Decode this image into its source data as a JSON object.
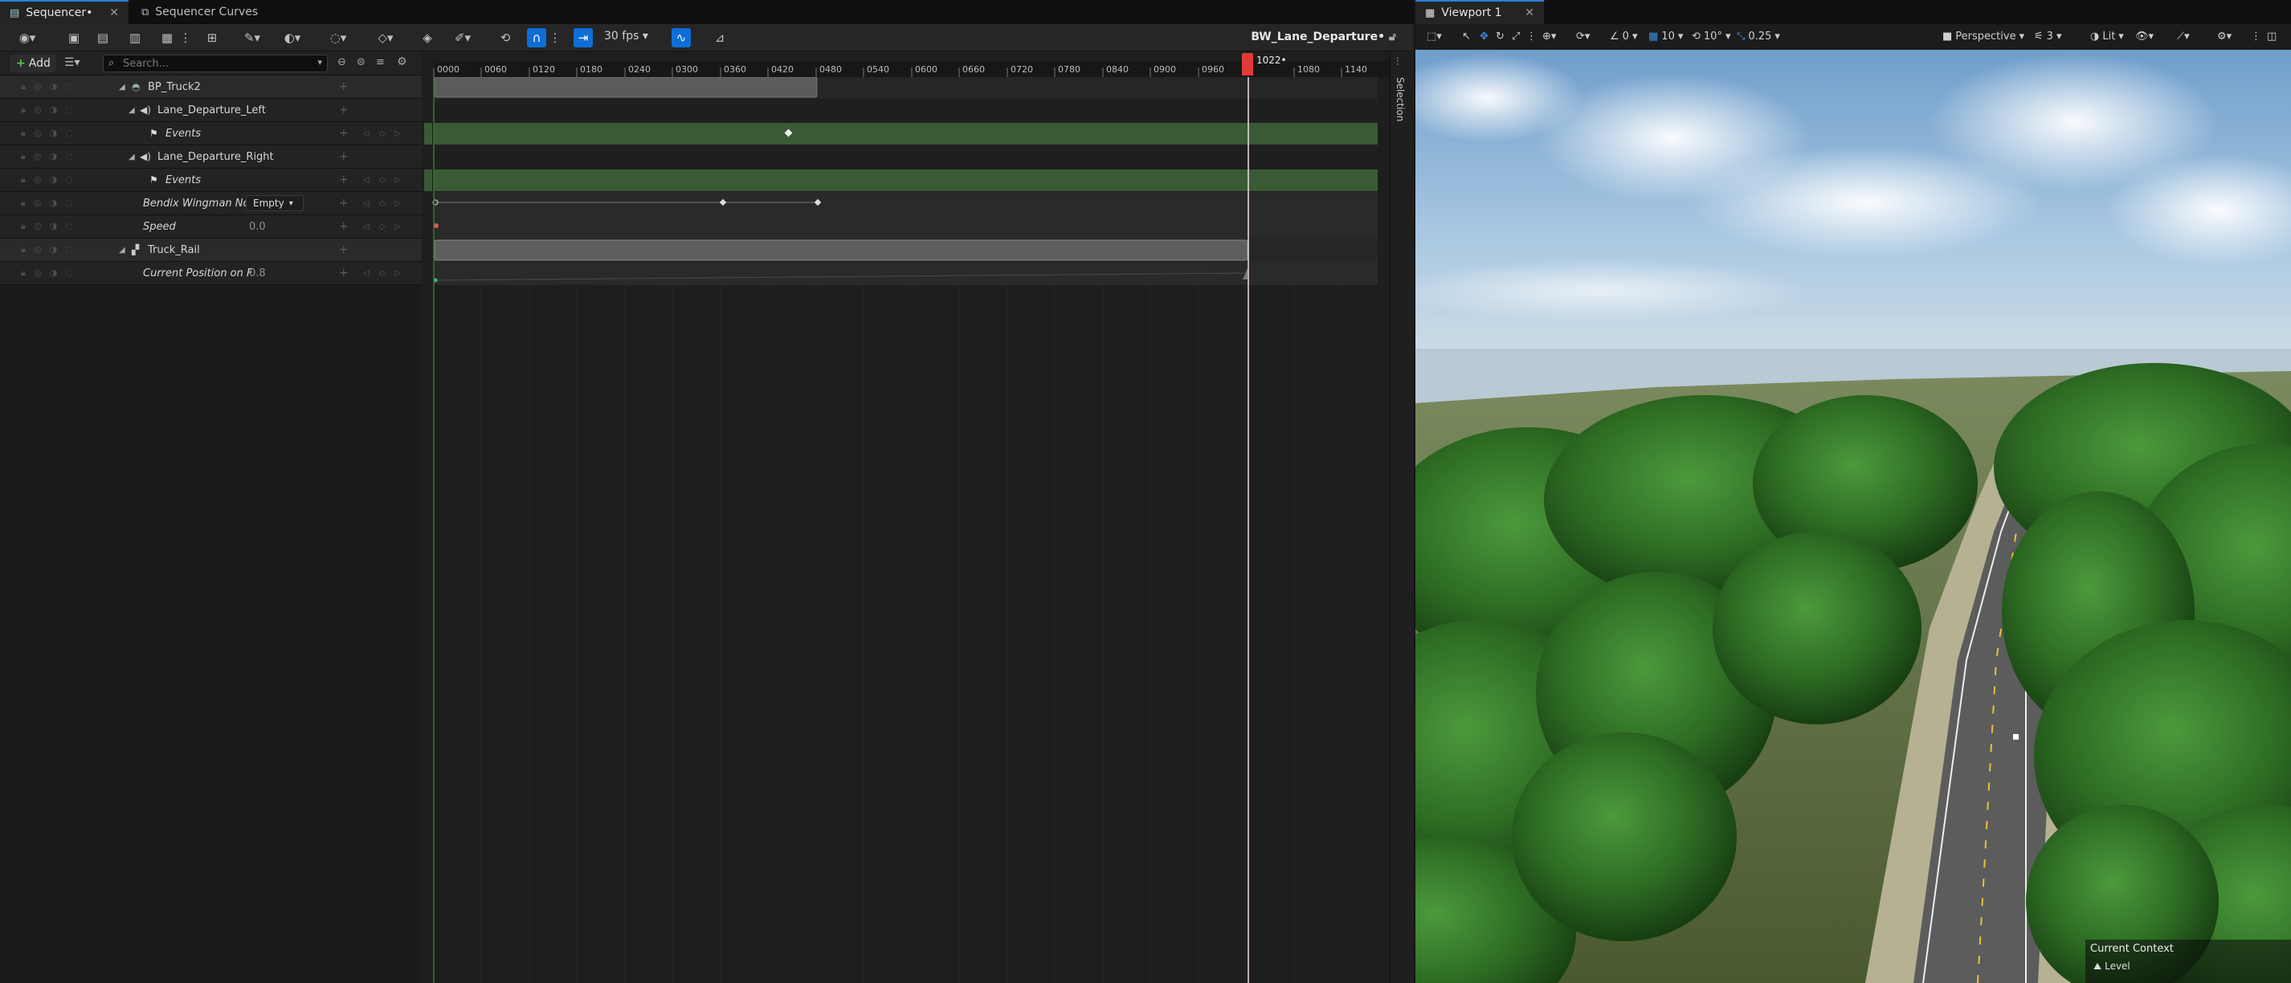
{
  "sequencer": {
    "tabs": [
      {
        "label": "Sequencer•",
        "close": "✕"
      },
      {
        "label": "Sequencer Curves"
      }
    ],
    "toolbar": {
      "fps": "30 fps",
      "sequence_name": "BW_Lane_Departure•"
    },
    "outliner": {
      "add_label": "Add",
      "search_placeholder": "Search...",
      "rows": [
        {
          "label": "BP_Truck2",
          "kind": "object"
        },
        {
          "label": "Lane_Departure_Left",
          "kind": "audio"
        },
        {
          "label": "Events",
          "kind": "event"
        },
        {
          "label": "Lane_Departure_Right",
          "kind": "audio"
        },
        {
          "label": "Events",
          "kind": "event"
        },
        {
          "label": "Bendix Wingman Not",
          "kind": "property",
          "value": "Empty"
        },
        {
          "label": "Speed",
          "kind": "property",
          "value": "0.0"
        },
        {
          "label": "Truck_Rail",
          "kind": "object"
        },
        {
          "label": "Current Position on F",
          "kind": "property",
          "value": "0.8"
        }
      ]
    },
    "ruler_ticks": [
      "0000",
      "0060",
      "0120",
      "0180",
      "0240",
      "0300",
      "0360",
      "0420",
      "0480",
      "0540",
      "0600",
      "0660",
      "0720",
      "0780",
      "0840",
      "0900",
      "0960",
      "1080",
      "1140"
    ],
    "playhead_frame": "1022•",
    "side_label": "Selection"
  },
  "viewport": {
    "tab_label": "Viewport 1",
    "tab_close": "✕",
    "toolbar": {
      "rot_snap": "0",
      "grid_snap": "10",
      "angle_snap": "10°",
      "scale_snap": "0.25",
      "view_mode": "Perspective",
      "lit_label": "Lit",
      "speed": "3"
    },
    "context": {
      "title": "Current Context",
      "value": "Level"
    }
  },
  "colors": {
    "accent_blue": "#0d6ed6",
    "event_track_green": "#3a5a36",
    "playhead_red": "#e23a3a",
    "section_gray": "#6a6a6a"
  }
}
